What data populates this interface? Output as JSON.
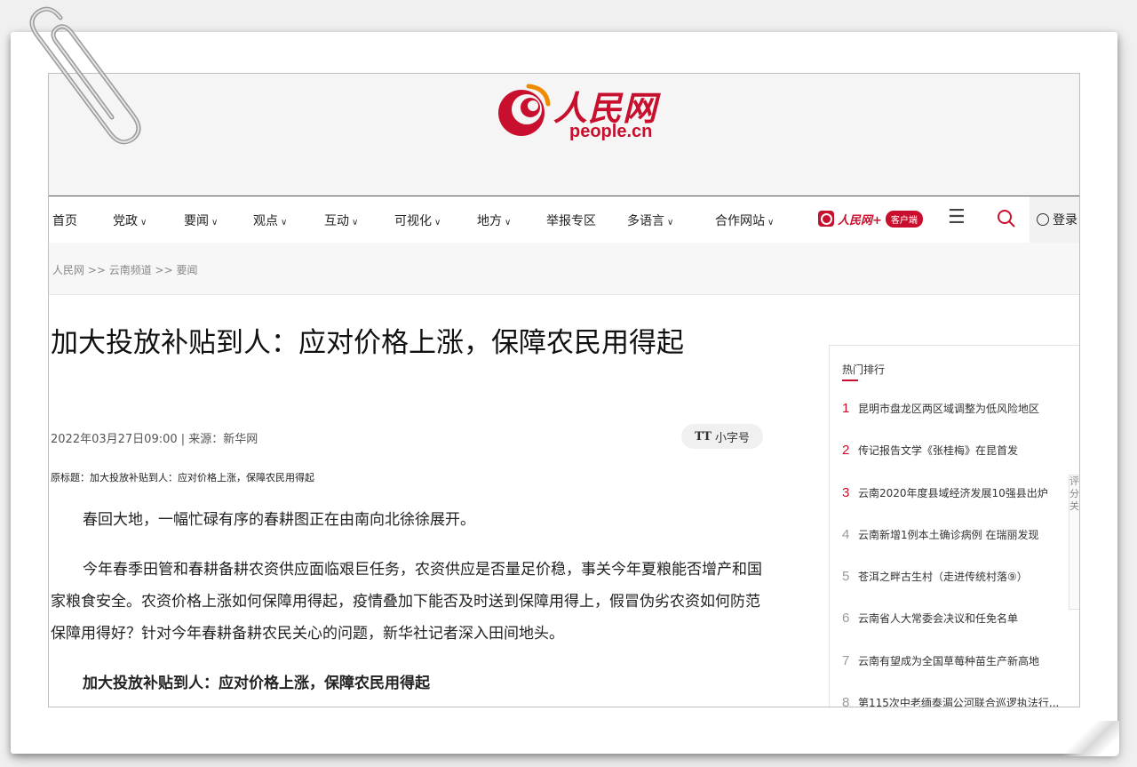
{
  "logo": {
    "cn": "人民网",
    "en": "people.cn"
  },
  "nav": {
    "items": [
      {
        "label": "首页",
        "caret": false
      },
      {
        "label": "党政",
        "caret": true
      },
      {
        "label": "要闻",
        "caret": true
      },
      {
        "label": "观点",
        "caret": true
      },
      {
        "label": "互动",
        "caret": true
      },
      {
        "label": "可视化",
        "caret": true
      },
      {
        "label": "地方",
        "caret": true
      },
      {
        "label": "举报专区",
        "caret": false
      },
      {
        "label": "多语言",
        "caret": true
      },
      {
        "label": "合作网站",
        "caret": true
      }
    ],
    "caret_glyph": "∨",
    "app_name": "人民网+",
    "app_pill": "客户端",
    "login": "登录"
  },
  "breadcrumb": "人民网 >> 云南频道 >> 要闻",
  "article": {
    "title": "加大投放补贴到人：应对价格上涨，保障农民用得起",
    "meta": "2022年03月27日09:00 | 来源：新华网",
    "font_button": "小字号",
    "font_button_icon": "TT",
    "original_title": "原标题：加大投放补贴到人：应对价格上涨，保障农民用得起",
    "paragraphs": [
      "春回大地，一幅忙碌有序的春耕图正在由南向北徐徐展开。",
      "今年春季田管和春耕备耕农资供应面临艰巨任务，农资供应是否量足价稳，事关今年夏粮能否增产和国家粮食安全。农资价格上涨如何保障用得起，疫情叠加下能否及时送到保障用得上，假冒伪劣农资如何防范保障用得好？针对今年春耕备耕农民关心的问题，新华社记者深入田间地头。",
      "加大投放补贴到人：应对价格上涨，保障农民用得起"
    ]
  },
  "sidebar": {
    "title": "热门排行",
    "items": [
      {
        "rank": "1",
        "text": "昆明市盘龙区两区域调整为低风险地区"
      },
      {
        "rank": "2",
        "text": "传记报告文学《张桂梅》在昆首发"
      },
      {
        "rank": "3",
        "text": "云南2020年度县域经济发展10强县出炉"
      },
      {
        "rank": "4",
        "text": "云南新增1例本土确诊病例 在瑞丽发现"
      },
      {
        "rank": "5",
        "text": "苍洱之畔古生村（走进传统村落⑨）"
      },
      {
        "rank": "6",
        "text": "云南省人大常委会决议和任免名单"
      },
      {
        "rank": "7",
        "text": "云南有望成为全国草莓种苗生产新高地"
      },
      {
        "rank": "8",
        "text": "第115次中老缅泰湄公河联合巡逻执法行..."
      }
    ]
  },
  "float_tools": "评分关",
  "colors": {
    "brand": "#c8102e",
    "text": "#222222",
    "muted": "#888888"
  },
  "icons": [
    "logo-swirl-icon",
    "caret-down-icon",
    "people-app-icon",
    "menu-icon",
    "search-icon",
    "user-icon",
    "paperclip-icon"
  ]
}
